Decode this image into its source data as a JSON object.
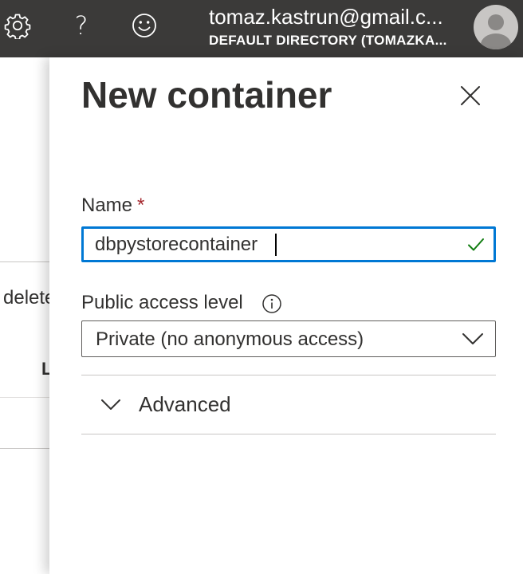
{
  "topbar": {
    "settings_icon": "gear-icon",
    "help_label": "?",
    "feedback_icon": "smiley-icon",
    "account": {
      "email": "tomaz.kastrun@gmail.c...",
      "directory": "DEFAULT DIRECTORY (TOMAZKA..."
    },
    "avatar_icon": "user-avatar-icon",
    "background_color": "#3b3a39"
  },
  "background_page": {
    "partial_text_delete": "delete",
    "partial_column_header": "L"
  },
  "blade": {
    "title": "New container",
    "close_icon": "close-icon",
    "name_field": {
      "label": "Name",
      "required_marker": "*",
      "value": "dbpystorecontainer",
      "valid_icon": "checkmark-icon"
    },
    "public_access": {
      "label": "Public access level",
      "info_icon": "info-icon",
      "selected": "Private (no anonymous access)"
    },
    "advanced": {
      "label": "Advanced",
      "expanded": false
    }
  },
  "colors": {
    "accent": "#0078d4",
    "valid": "#107c10",
    "required": "#a4262c"
  }
}
